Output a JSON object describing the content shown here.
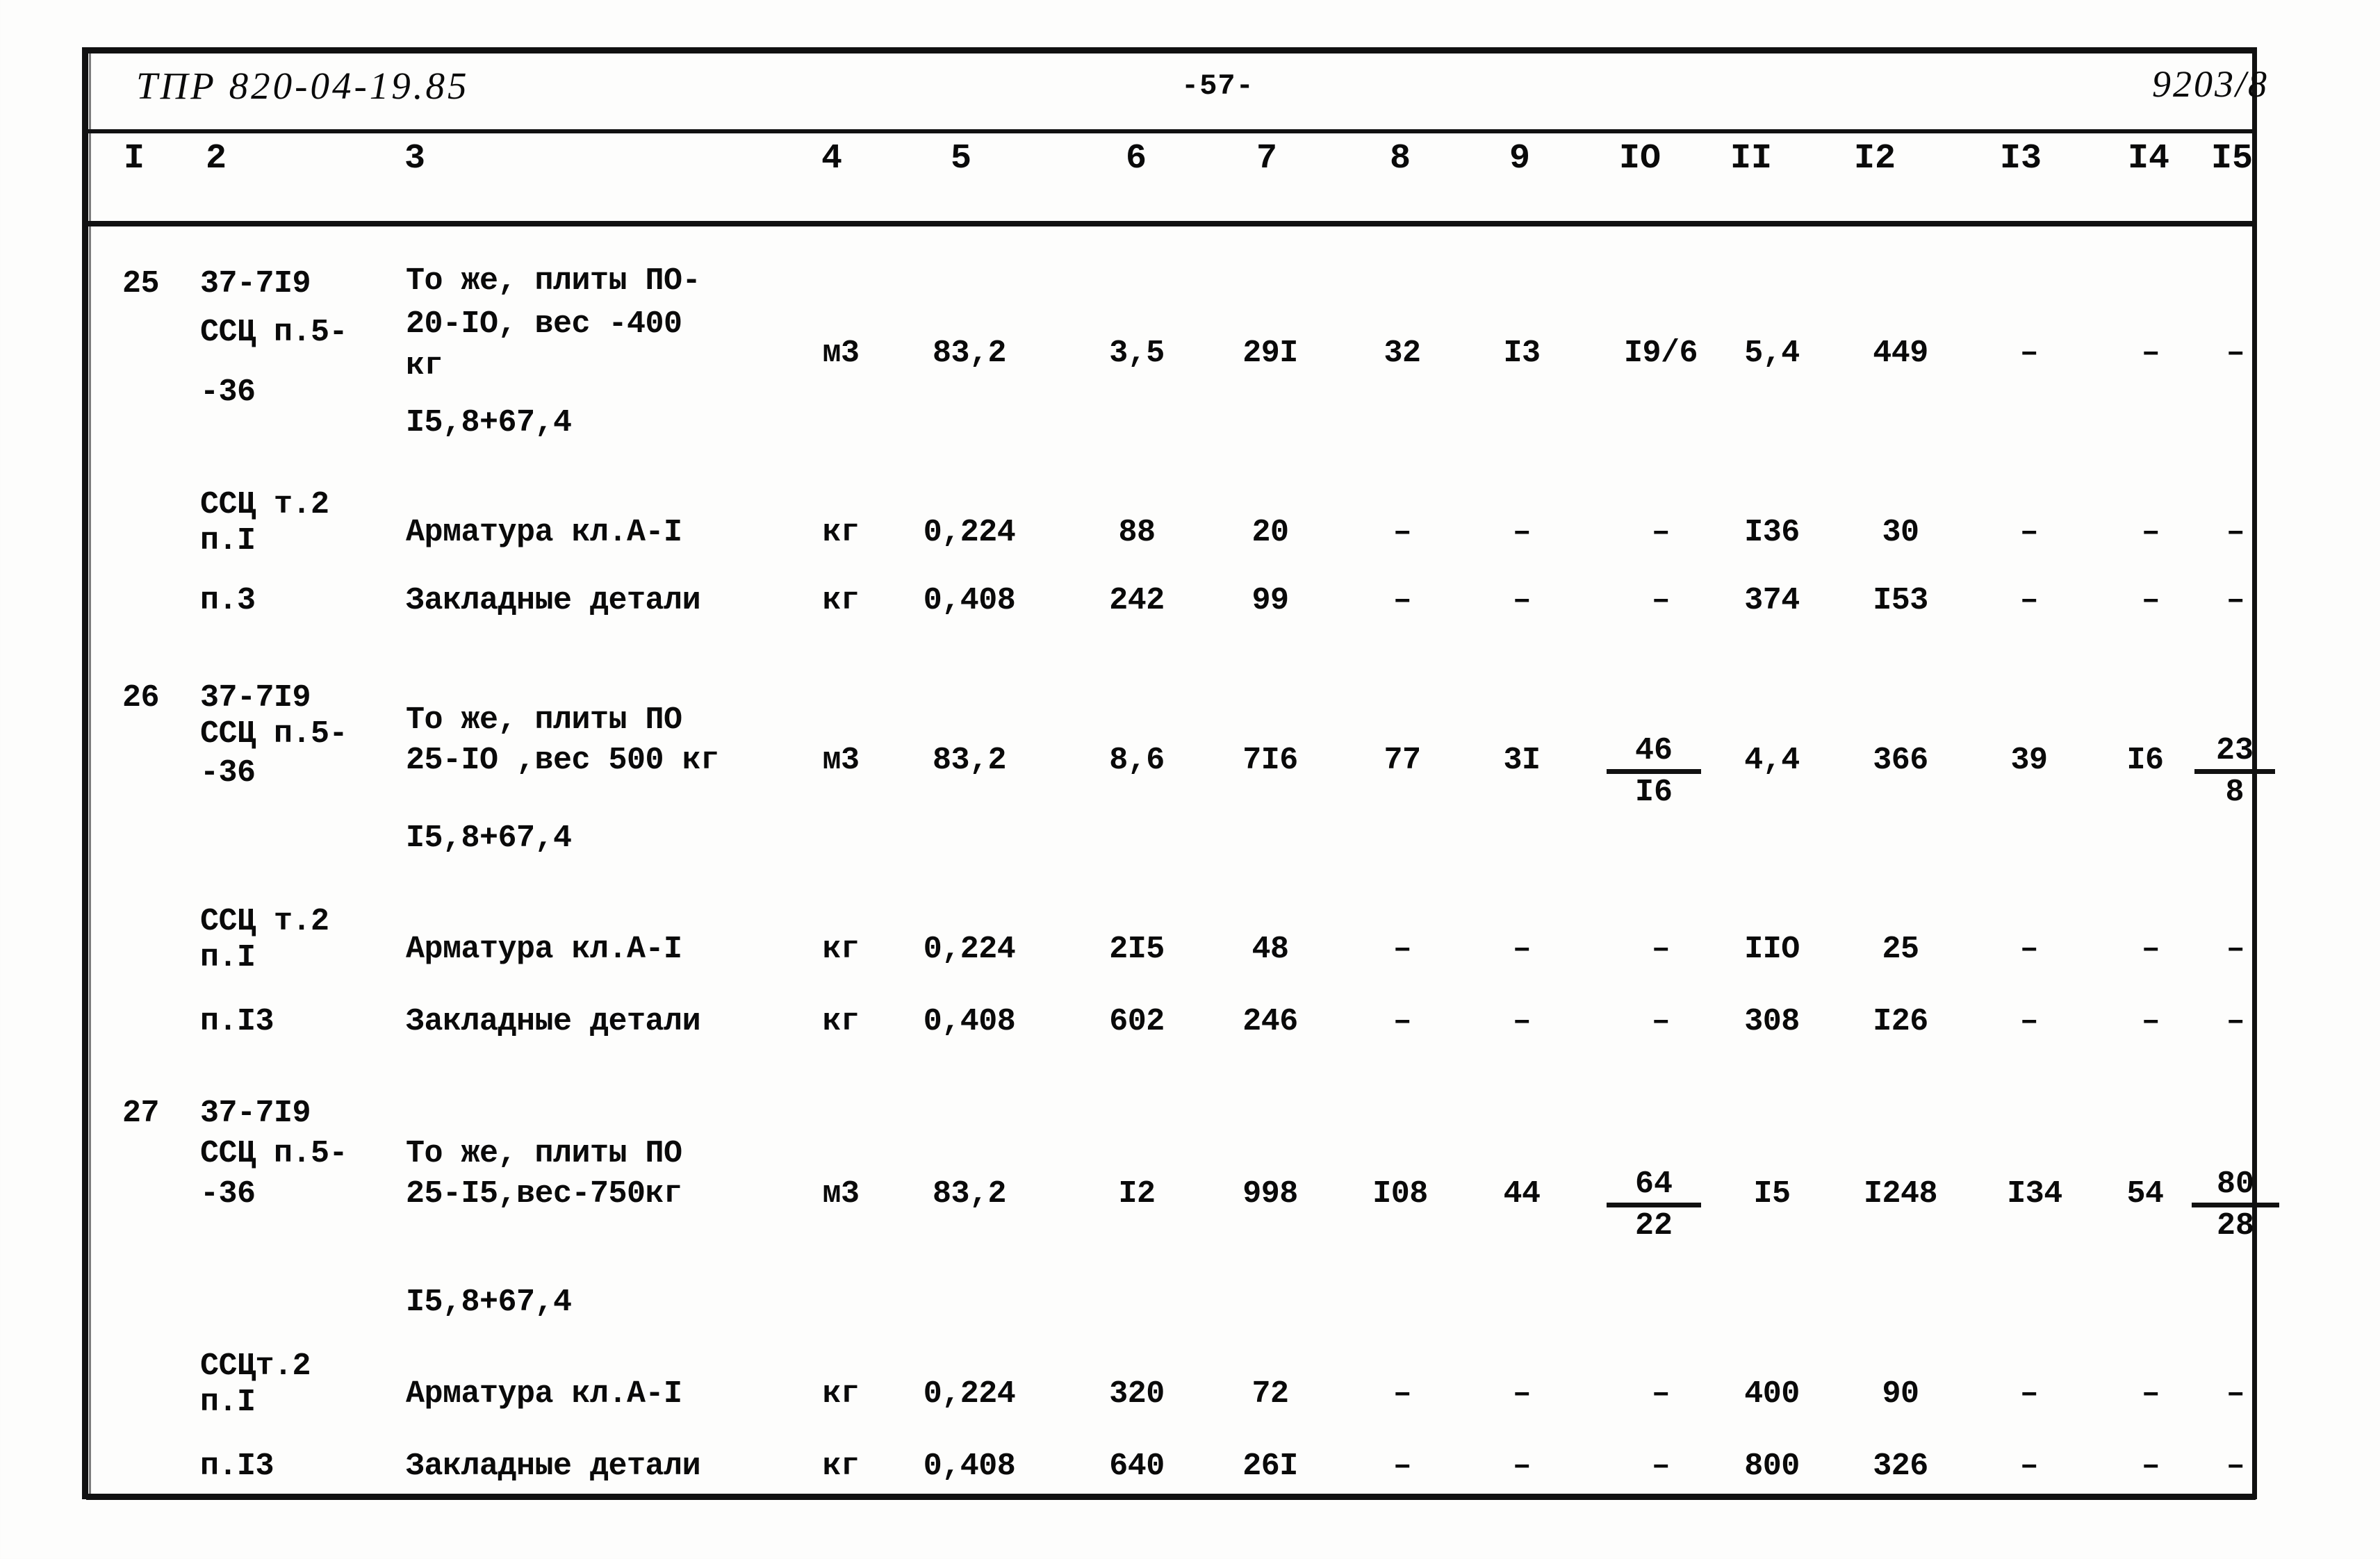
{
  "header": {
    "document_code": "ТПР 820-04-19.85",
    "page_number": "-57-",
    "sheet_code": "9203/8"
  },
  "table": {
    "column_numbers": [
      "I",
      "2",
      "3",
      "4",
      "5",
      "6",
      "7",
      "8",
      "9",
      "IO",
      "II",
      "I2",
      "I3",
      "I4",
      "I5"
    ],
    "rows": [
      {
        "id": "row-25",
        "col1": "25",
        "col2_line1": "37-7I9",
        "col2_line2": "ССЦ п.5-",
        "col2_line3": "-36",
        "col3_line1": "То же, плиты ПО-",
        "col3_line2": "20-IO, вес -400",
        "col3_line3": "кг",
        "col3_line4": "I5,8+67,4",
        "col4": "м3",
        "col5": "83,2",
        "col6": "3,5",
        "col7": "29I",
        "col8": "32",
        "col9": "I3",
        "col10": "I9/6",
        "col11": "5,4",
        "col12": "449",
        "col13": "–",
        "col14": "–",
        "col15": "–"
      },
      {
        "id": "row-25a",
        "col2_line1": "ССЦ т.2",
        "col2_line2": "п.I",
        "col3": "Арматура кл.А-I",
        "col4": "кг",
        "col5": "0,224",
        "col6": "88",
        "col7": "20",
        "col8": "–",
        "col9": "–",
        "col10": "–",
        "col11": "I36",
        "col12": "30",
        "col13": "–",
        "col14": "–",
        "col15": "–"
      },
      {
        "id": "row-25b",
        "col2_line2": "п.3",
        "col3": "Закладные детали",
        "col4": "кг",
        "col5": "0,408",
        "col6": "242",
        "col7": "99",
        "col8": "–",
        "col9": "–",
        "col10": "–",
        "col11": "374",
        "col12": "I53",
        "col13": "–",
        "col14": "–",
        "col15": "–"
      },
      {
        "id": "row-26",
        "col1": "26",
        "col2_line1": "37-7I9",
        "col2_line2": "ССЦ п.5-",
        "col2_line3": "-36",
        "col3_line1": "То же, плиты ПО",
        "col3_line2": "25-IO ,вес 500 кг",
        "col3_line4": "I5,8+67,4",
        "col4": "м3",
        "col5": "83,2",
        "col6": "8,6",
        "col7": "7I6",
        "col8": "77",
        "col9": "3I",
        "col10_num": "46",
        "col10_den": "I6",
        "col11": "4,4",
        "col12": "366",
        "col13": "39",
        "col14": "I6",
        "col15_num": "23",
        "col15_den": "8"
      },
      {
        "id": "row-26a",
        "col2_line1": "ССЦ т.2",
        "col2_line2": "п.I",
        "col3": "Арматура кл.А-I",
        "col4": "кг",
        "col5": "0,224",
        "col6": "2I5",
        "col7": "48",
        "col8": "–",
        "col9": "–",
        "col10": "–",
        "col11": "IIO",
        "col12": "25",
        "col13": "–",
        "col14": "–",
        "col15": "–"
      },
      {
        "id": "row-26b",
        "col2_line2": "п.I3",
        "col3": "Закладные детали",
        "col4": "кг",
        "col5": "0,408",
        "col6": "602",
        "col7": "246",
        "col8": "–",
        "col9": "–",
        "col10": "–",
        "col11": "308",
        "col12": "I26",
        "col13": "–",
        "col14": "–",
        "col15": "–"
      },
      {
        "id": "row-27",
        "col1": "27",
        "col2_line1": "37-7I9",
        "col2_line2": "ССЦ п.5-",
        "col2_line3": "-36",
        "col3_line1": "То же, плиты ПО",
        "col3_line2": "25-I5,вес-750кг",
        "col3_line4": "I5,8+67,4",
        "col4": "м3",
        "col5": "83,2",
        "col6": "I2",
        "col7": "998",
        "col8": "I08",
        "col9": "44",
        "col10_num": "64",
        "col10_den": "22",
        "col11": "I5",
        "col12": "I248",
        "col13": "I34",
        "col14": "54",
        "col15_num": "80",
        "col15_den": "28"
      },
      {
        "id": "row-27a",
        "col2_line1": "ССЦт.2",
        "col2_line2": "п.I",
        "col3": "Арматура кл.А-I",
        "col4": "кг",
        "col5": "0,224",
        "col6": "320",
        "col7": "72",
        "col8": "–",
        "col9": "–",
        "col10": "–",
        "col11": "400",
        "col12": "90",
        "col13": "–",
        "col14": "–",
        "col15": "–"
      },
      {
        "id": "row-27b",
        "col2_line2": "п.I3",
        "col3": "Закладные детали",
        "col4": "кг",
        "col5": "0,408",
        "col6": "640",
        "col7": "26I",
        "col8": "–",
        "col9": "–",
        "col10": "–",
        "col11": "800",
        "col12": "326",
        "col13": "–",
        "col14": "–",
        "col15": "–"
      }
    ]
  }
}
